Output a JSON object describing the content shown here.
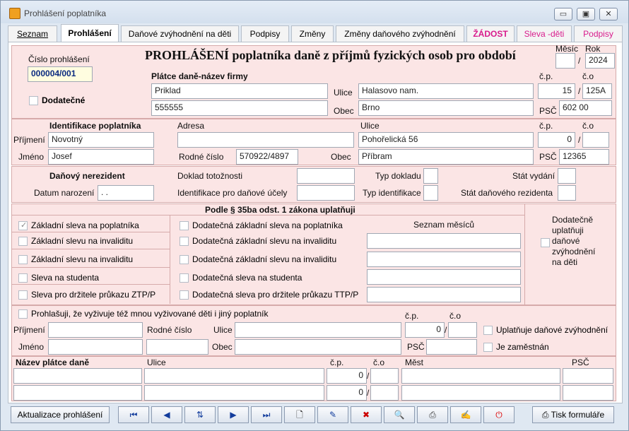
{
  "window": {
    "title": "Prohlášení poplatníka"
  },
  "tabs": [
    "Seznam",
    "Prohlášení",
    "Daňové zvýhodnění na děti",
    "Podpisy",
    "Změny",
    "Změny daňového zvýhodnění",
    "ŽÁDOST",
    "Sleva -děti",
    "Podpisy"
  ],
  "colors": {
    "accent_pink": "#d81b8c",
    "panel_pink": "#fbe5e5",
    "doc_number": "#0a2a80"
  },
  "header": {
    "cislo_label": "Číslo prohlášení",
    "cislo_value": "000004/001",
    "dodatecne_label": "Dodatečné",
    "title": "PROHLÁŠENÍ poplatníka daně z příjmů fyzických osob pro období",
    "mesic_label": "Měsíc",
    "rok_label": "Rok",
    "mesic_value": "",
    "rok_value": "2024",
    "slash": "/"
  },
  "platce": {
    "heading": "Plátce daně-název firmy",
    "name1": "Priklad",
    "name2": "555555",
    "ulice_label": "Ulice",
    "ulice": "Halasovo nam.",
    "obec_label": "Obec",
    "obec": "Brno",
    "cp_label": "č.p.",
    "co_label": "č.o",
    "cp": "15",
    "co": "125A",
    "psc_label": "PSČ",
    "psc": "602 00"
  },
  "identifikace": {
    "heading": "Identifikace poplatníka",
    "prijmeni_label": "Příjmení",
    "prijmeni": "Novotný",
    "jmeno_label": "Jméno",
    "jmeno": "Josef",
    "adresa_label": "Adresa",
    "adresa": "",
    "rc_label": "Rodné číslo",
    "rc": "570922/4897",
    "ulice_label": "Ulice",
    "ulice": "Pohořelická 56",
    "obec_label": "Obec",
    "obec": "Příbram",
    "cp_label": "č.p.",
    "co_label": "č.o",
    "cp": "0",
    "co": "",
    "psc_label": "PSČ",
    "psc": "12365"
  },
  "nerezident": {
    "heading": "Daňový nerezident",
    "datum_label": "Datum narození",
    "datum": " . .",
    "doklad_label": "Doklad totožnosti",
    "idfu_label": "Identifikace pro daňové účely",
    "typ_dokladu_label": "Typ dokladu",
    "typ_id_label": "Typ identifikace",
    "stat_vydani_label": "Stát vydání",
    "stat_rez_label": "Stát daňového rezidenta"
  },
  "slevy": {
    "heading": "Podle § 35ba odst. 1 zákona uplatňuji",
    "seznam_label": "Seznam měsíců",
    "left": [
      {
        "label": "Základní sleva na poplatníka",
        "checked": true
      },
      {
        "label": "Základní slevu na invaliditu",
        "checked": false
      },
      {
        "label": "Základní slevu na invaliditu",
        "checked": false
      },
      {
        "label": "Sleva na studenta",
        "checked": false
      },
      {
        "label": "Sleva pro držitele průkazu ZTP/P",
        "checked": false
      }
    ],
    "right": [
      {
        "label": "Dodatečná základní sleva na poplatníka"
      },
      {
        "label": "Dodatečná základní slevu na invaliditu"
      },
      {
        "label": "Dodatečná základní slevu na invaliditu"
      },
      {
        "label": "Dodatečná sleva na studenta"
      },
      {
        "label": "Dodatečná sleva pro držitele průkazu TTP/P"
      }
    ],
    "side_label": "Dodatečně uplatňuji daňové zvýhodnění na děti"
  },
  "druhy": {
    "prohlasuji_label": "Prohlašuji, že vyživuje též mnou vyživované děti i jiný poplatník",
    "prijmeni_label": "Příjmení",
    "rc_label": "Rodné číslo",
    "ulice_label": "Ulice",
    "jmeno_label": "Jméno",
    "obec_label": "Obec",
    "cp_label": "č.p.",
    "co_label": "č.o",
    "cp": "0",
    "psc_label": "PSČ",
    "uplatnuje_label": "Uplatňuje daňové zvýhodnění",
    "zamestnan_label": "Je zaměstnán"
  },
  "platce2": {
    "nazev_label": "Název plátce daně",
    "ulice_label": "Ulice",
    "cp_label": "č.p.",
    "co_label": "č.o",
    "mest_label": "Měst",
    "psc_label": "PSČ",
    "cp1": "0",
    "cp2": "0"
  },
  "bottom": {
    "aktualizace": "Aktualizace prohlášení",
    "tisk": "Tisk formuláře"
  }
}
